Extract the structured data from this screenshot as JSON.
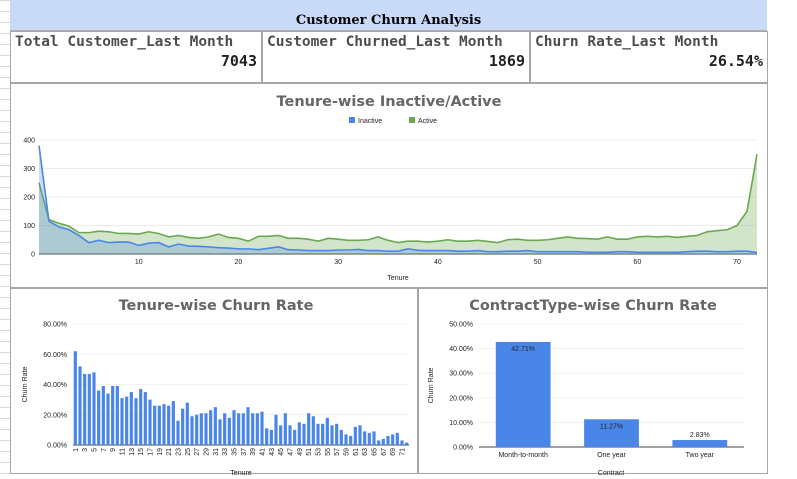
{
  "header": {
    "title": "Customer Churn Analysis"
  },
  "kpis": [
    {
      "label": "Total Customer_Last Month",
      "value": "7043"
    },
    {
      "label": "Customer Churned_Last Month",
      "value": "1869"
    },
    {
      "label": "Churn Rate_Last Month",
      "value": "26.54%"
    }
  ],
  "colors": {
    "inactive": "#4a86e8",
    "active": "#6aa84f",
    "bar": "#4a86e8",
    "header_bg": "#c9daf8"
  },
  "chart_data": [
    {
      "type": "area",
      "title": "Tenure-wise Inactive/Active",
      "xlabel": "Tenure",
      "ylabel": "",
      "xlim": [
        0,
        72
      ],
      "ylim": [
        0,
        400
      ],
      "yticks": [
        "0",
        "100",
        "200",
        "300",
        "400"
      ],
      "xticks": [
        "10",
        "20",
        "30",
        "40",
        "50",
        "60",
        "70"
      ],
      "legend": "top-center",
      "x": [
        0,
        1,
        2,
        3,
        4,
        5,
        6,
        7,
        8,
        9,
        10,
        11,
        12,
        13,
        14,
        15,
        16,
        17,
        18,
        19,
        20,
        21,
        22,
        23,
        24,
        25,
        26,
        27,
        28,
        29,
        30,
        31,
        32,
        33,
        34,
        35,
        36,
        37,
        38,
        39,
        40,
        41,
        42,
        43,
        44,
        45,
        46,
        47,
        48,
        49,
        50,
        51,
        52,
        53,
        54,
        55,
        56,
        57,
        58,
        59,
        60,
        61,
        62,
        63,
        64,
        65,
        66,
        67,
        68,
        69,
        70,
        71,
        72
      ],
      "series": [
        {
          "name": "Inactive",
          "values": [
            380,
            115,
            95,
            85,
            65,
            40,
            48,
            40,
            42,
            42,
            30,
            38,
            40,
            25,
            35,
            28,
            27,
            25,
            22,
            21,
            18,
            18,
            15,
            20,
            25,
            15,
            14,
            12,
            12,
            12,
            14,
            14,
            16,
            12,
            12,
            10,
            10,
            18,
            13,
            12,
            12,
            12,
            10,
            10,
            12,
            8,
            8,
            10,
            10,
            12,
            8,
            8,
            8,
            8,
            8,
            6,
            6,
            6,
            8,
            8,
            6,
            6,
            6,
            6,
            6,
            8,
            10,
            10,
            8,
            8,
            10,
            10,
            5
          ]
        },
        {
          "name": "Active",
          "values": [
            250,
            120,
            108,
            98,
            75,
            75,
            80,
            78,
            72,
            72,
            70,
            78,
            72,
            60,
            65,
            58,
            55,
            60,
            70,
            58,
            55,
            45,
            62,
            62,
            65,
            55,
            55,
            52,
            45,
            55,
            52,
            48,
            48,
            50,
            60,
            48,
            40,
            45,
            45,
            42,
            45,
            50,
            45,
            45,
            48,
            44,
            40,
            50,
            52,
            48,
            48,
            50,
            55,
            60,
            55,
            54,
            52,
            60,
            52,
            52,
            60,
            62,
            60,
            62,
            58,
            62,
            65,
            78,
            82,
            85,
            100,
            150,
            350
          ]
        }
      ]
    },
    {
      "type": "bar",
      "title": "Tenure-wise Churn Rate",
      "xlabel": "Tenure",
      "ylabel": "Churn Rate",
      "ylim": [
        0,
        0.8
      ],
      "yticks": [
        "0.00%",
        "20.00%",
        "40.00%",
        "60.00%",
        "80.00%"
      ],
      "xtick_labels": [
        "1",
        "3",
        "5",
        "7",
        "9",
        "11",
        "13",
        "15",
        "17",
        "19",
        "21",
        "23",
        "25",
        "27",
        "29",
        "31",
        "33",
        "35",
        "37",
        "39",
        "41",
        "43",
        "45",
        "47",
        "49",
        "51",
        "53",
        "55",
        "57",
        "59",
        "61",
        "63",
        "65",
        "67",
        "69",
        "71"
      ],
      "categories": [
        "1",
        "2",
        "3",
        "4",
        "5",
        "6",
        "7",
        "8",
        "9",
        "10",
        "11",
        "12",
        "13",
        "14",
        "15",
        "16",
        "17",
        "18",
        "19",
        "20",
        "21",
        "22",
        "23",
        "24",
        "25",
        "26",
        "27",
        "28",
        "29",
        "30",
        "31",
        "32",
        "33",
        "34",
        "35",
        "36",
        "37",
        "38",
        "39",
        "40",
        "41",
        "42",
        "43",
        "44",
        "45",
        "46",
        "47",
        "48",
        "49",
        "50",
        "51",
        "52",
        "53",
        "54",
        "55",
        "56",
        "57",
        "58",
        "59",
        "60",
        "61",
        "62",
        "63",
        "64",
        "65",
        "66",
        "67",
        "68",
        "69",
        "70",
        "71",
        "72"
      ],
      "values": [
        0.62,
        0.52,
        0.47,
        0.47,
        0.48,
        0.36,
        0.39,
        0.34,
        0.39,
        0.39,
        0.31,
        0.32,
        0.35,
        0.31,
        0.37,
        0.35,
        0.3,
        0.26,
        0.26,
        0.27,
        0.26,
        0.29,
        0.16,
        0.24,
        0.28,
        0.19,
        0.2,
        0.21,
        0.21,
        0.23,
        0.25,
        0.17,
        0.21,
        0.18,
        0.23,
        0.21,
        0.21,
        0.25,
        0.21,
        0.21,
        0.22,
        0.11,
        0.1,
        0.2,
        0.13,
        0.21,
        0.13,
        0.1,
        0.15,
        0.14,
        0.21,
        0.19,
        0.14,
        0.14,
        0.18,
        0.13,
        0.14,
        0.1,
        0.07,
        0.06,
        0.12,
        0.13,
        0.09,
        0.08,
        0.09,
        0.03,
        0.04,
        0.06,
        0.07,
        0.08,
        0.03,
        0.016
      ]
    },
    {
      "type": "bar",
      "title": "ContractType-wise Churn Rate",
      "xlabel": "Contract",
      "ylabel": "Churn Rate",
      "ylim": [
        0,
        0.5
      ],
      "yticks": [
        "0.00%",
        "10.00%",
        "20.00%",
        "30.00%",
        "40.00%",
        "50.00%"
      ],
      "categories": [
        "Month-to-month",
        "One year",
        "Two year"
      ],
      "values": [
        0.4271,
        0.1127,
        0.0283
      ],
      "data_labels": [
        "42.71%",
        "11.27%",
        "2.83%"
      ]
    }
  ]
}
